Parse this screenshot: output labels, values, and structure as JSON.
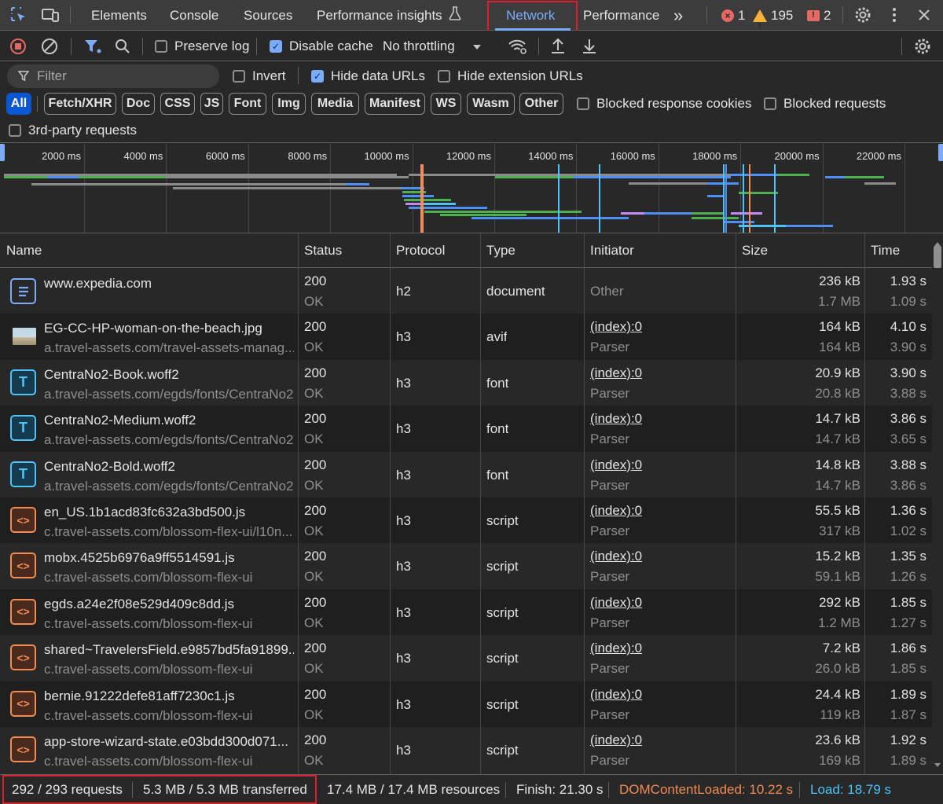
{
  "tabs": {
    "elements": "Elements",
    "console": "Console",
    "sources": "Sources",
    "performance_insights": "Performance insights",
    "network": "Network",
    "performance": "Performance",
    "more": "»",
    "errors": "1",
    "warnings": "195",
    "issues": "2"
  },
  "toolbar": {
    "preserve_log": "Preserve log",
    "disable_cache": "Disable cache",
    "throttling": "No throttling"
  },
  "filter": {
    "placeholder": "Filter",
    "invert": "Invert",
    "hide_data_urls": "Hide data URLs",
    "hide_extension_urls": "Hide extension URLs",
    "types": [
      "All",
      "Fetch/XHR",
      "Doc",
      "CSS",
      "JS",
      "Font",
      "Img",
      "Media",
      "Manifest",
      "WS",
      "Wasm",
      "Other"
    ],
    "blocked_response_cookies": "Blocked response cookies",
    "blocked_requests": "Blocked requests",
    "third_party": "3rd-party requests"
  },
  "overview": {
    "ticks": [
      "2000 ms",
      "4000 ms",
      "6000 ms",
      "8000 ms",
      "10000 ms",
      "12000 ms",
      "14000 ms",
      "16000 ms",
      "18000 ms",
      "20000 ms",
      "22000 ms"
    ]
  },
  "columns": {
    "name": "Name",
    "status": "Status",
    "protocol": "Protocol",
    "type": "Type",
    "initiator": "Initiator",
    "size": "Size",
    "time": "Time"
  },
  "rows": [
    {
      "icon": "document",
      "name": "www.expedia.com",
      "path": "",
      "status": "200",
      "status_text": "OK",
      "protocol": "h2",
      "type": "document",
      "initiator": "Other",
      "initiator_sub": "",
      "size": "236 kB",
      "size_sub": "1.7 MB",
      "time": "1.93 s",
      "time_sub": "1.09 s"
    },
    {
      "icon": "image",
      "name": "EG-CC-HP-woman-on-the-beach.jpg",
      "path": "a.travel-assets.com/travel-assets-manag...",
      "status": "200",
      "status_text": "OK",
      "protocol": "h3",
      "type": "avif",
      "initiator": "(index):0",
      "initiator_sub": "Parser",
      "size": "164 kB",
      "size_sub": "164 kB",
      "time": "4.10 s",
      "time_sub": "3.90 s"
    },
    {
      "icon": "font",
      "name": "CentraNo2-Book.woff2",
      "path": "a.travel-assets.com/egds/fonts/CentraNo2",
      "status": "200",
      "status_text": "OK",
      "protocol": "h3",
      "type": "font",
      "initiator": "(index):0",
      "initiator_sub": "Parser",
      "size": "20.9 kB",
      "size_sub": "20.8 kB",
      "time": "3.90 s",
      "time_sub": "3.88 s"
    },
    {
      "icon": "font",
      "name": "CentraNo2-Medium.woff2",
      "path": "a.travel-assets.com/egds/fonts/CentraNo2",
      "status": "200",
      "status_text": "OK",
      "protocol": "h3",
      "type": "font",
      "initiator": "(index):0",
      "initiator_sub": "Parser",
      "size": "14.7 kB",
      "size_sub": "14.7 kB",
      "time": "3.86 s",
      "time_sub": "3.65 s"
    },
    {
      "icon": "font",
      "name": "CentraNo2-Bold.woff2",
      "path": "a.travel-assets.com/egds/fonts/CentraNo2",
      "status": "200",
      "status_text": "OK",
      "protocol": "h3",
      "type": "font",
      "initiator": "(index):0",
      "initiator_sub": "Parser",
      "size": "14.8 kB",
      "size_sub": "14.7 kB",
      "time": "3.88 s",
      "time_sub": "3.86 s"
    },
    {
      "icon": "script",
      "name": "en_US.1b1acd83fc632a3bd500.js",
      "path": "c.travel-assets.com/blossom-flex-ui/l10n...",
      "status": "200",
      "status_text": "OK",
      "protocol": "h3",
      "type": "script",
      "initiator": "(index):0",
      "initiator_sub": "Parser",
      "size": "55.5 kB",
      "size_sub": "317 kB",
      "time": "1.36 s",
      "time_sub": "1.02 s"
    },
    {
      "icon": "script",
      "name": "mobx.4525b6976a9ff5514591.js",
      "path": "c.travel-assets.com/blossom-flex-ui",
      "status": "200",
      "status_text": "OK",
      "protocol": "h3",
      "type": "script",
      "initiator": "(index):0",
      "initiator_sub": "Parser",
      "size": "15.2 kB",
      "size_sub": "59.1 kB",
      "time": "1.35 s",
      "time_sub": "1.26 s"
    },
    {
      "icon": "script",
      "name": "egds.a24e2f08e529d409c8dd.js",
      "path": "c.travel-assets.com/blossom-flex-ui",
      "status": "200",
      "status_text": "OK",
      "protocol": "h3",
      "type": "script",
      "initiator": "(index):0",
      "initiator_sub": "Parser",
      "size": "292 kB",
      "size_sub": "1.2 MB",
      "time": "1.85 s",
      "time_sub": "1.27 s"
    },
    {
      "icon": "script",
      "name": "shared~TravelersField.e9857bd5fa91899...",
      "path": "c.travel-assets.com/blossom-flex-ui",
      "status": "200",
      "status_text": "OK",
      "protocol": "h3",
      "type": "script",
      "initiator": "(index):0",
      "initiator_sub": "Parser",
      "size": "7.2 kB",
      "size_sub": "26.0 kB",
      "time": "1.86 s",
      "time_sub": "1.85 s"
    },
    {
      "icon": "script",
      "name": "bernie.91222defe81aff7230c1.js",
      "path": "c.travel-assets.com/blossom-flex-ui",
      "status": "200",
      "status_text": "OK",
      "protocol": "h3",
      "type": "script",
      "initiator": "(index):0",
      "initiator_sub": "Parser",
      "size": "24.4 kB",
      "size_sub": "119 kB",
      "time": "1.89 s",
      "time_sub": "1.87 s"
    },
    {
      "icon": "script",
      "name": "app-store-wizard-state.e03bdd300d071...",
      "path": "c.travel-assets.com/blossom-flex-ui",
      "status": "200",
      "status_text": "OK",
      "protocol": "h3",
      "type": "script",
      "initiator": "(index):0",
      "initiator_sub": "Parser",
      "size": "23.6 kB",
      "size_sub": "169 kB",
      "time": "1.92 s",
      "time_sub": "1.89 s"
    }
  ],
  "status_bar": {
    "requests": "292 / 293 requests",
    "transferred": "5.3 MB / 5.3 MB transferred",
    "resources": "17.4 MB / 17.4 MB resources",
    "finish": "Finish: 21.30 s",
    "dom_content_loaded": "DOMContentLoaded: 10.22 s",
    "load": "Load: 18.79 s"
  },
  "colors": {
    "accent": "#7cacf8",
    "dom_content_loaded": "#f28b54",
    "load": "#4ec3f7",
    "highlight_box": "#e01d2a"
  }
}
